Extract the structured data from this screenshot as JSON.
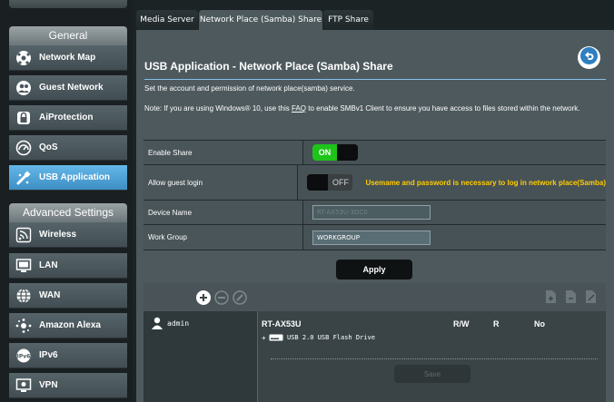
{
  "sidebar": {
    "general_header": "General",
    "advanced_header": "Advanced Settings",
    "general_items": [
      {
        "label": "Network Map",
        "icon": "network-map-icon"
      },
      {
        "label": "Guest Network",
        "icon": "guest-network-icon"
      },
      {
        "label": "AiProtection",
        "icon": "aiprotection-lock-icon"
      },
      {
        "label": "QoS",
        "icon": "qos-gauge-icon"
      },
      {
        "label": "USB Application",
        "icon": "usb-application-icon",
        "active": true
      }
    ],
    "advanced_items": [
      {
        "label": "Wireless",
        "icon": "wireless-icon"
      },
      {
        "label": "LAN",
        "icon": "lan-icon"
      },
      {
        "label": "WAN",
        "icon": "wan-globe-icon"
      },
      {
        "label": "Amazon Alexa",
        "icon": "amazon-alexa-icon"
      },
      {
        "label": "IPv6",
        "icon": "ipv6-icon"
      },
      {
        "label": "VPN",
        "icon": "vpn-icon"
      }
    ]
  },
  "tabs": [
    {
      "label": "Media Server"
    },
    {
      "label": "Network Place (Samba) Share",
      "active": true
    },
    {
      "label": "FTP Share"
    }
  ],
  "main": {
    "title": "USB Application - Network Place (Samba) Share",
    "description": "Set the account and permission of network place(samba) service.",
    "note_prefix": "Note: If you are using Windows® 10, use this ",
    "note_link": "FAQ",
    "note_suffix": " to enable SMBv1 Client to ensure you have access to files stored within the network.",
    "settings": {
      "enable_share": {
        "label": "Enable Share",
        "state_text": "ON"
      },
      "allow_guest": {
        "label": "Allow guest login",
        "state_text": "OFF",
        "warning": "Usemame and password is necessary to log in network place(Samba)"
      },
      "device_name": {
        "label": "Device Name",
        "value": "RT-AX53U-3DC0"
      },
      "work_group": {
        "label": "Work Group",
        "value": "WORKGROUP"
      }
    },
    "apply_label": "Apply",
    "accounts": {
      "user": "admin",
      "device": "RT-AX53U",
      "perm_headers": [
        "R/W",
        "R",
        "No"
      ],
      "drive_expand": "+",
      "drive_label": "USB 2.0 USB Flash Drive",
      "save_label": "Save"
    }
  },
  "colors": {
    "accent_blue": "#3d8fc4",
    "toggle_green": "#1ec41a",
    "warning_yellow": "#ffcc00",
    "panel_bg": "#4d595d"
  }
}
